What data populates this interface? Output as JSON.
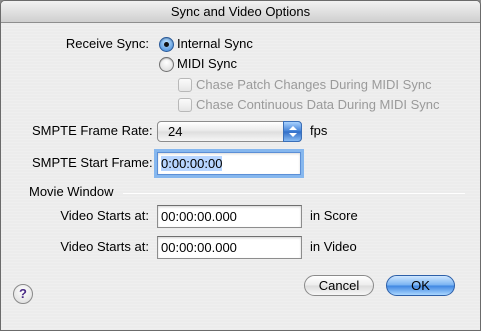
{
  "window": {
    "title": "Sync and Video Options"
  },
  "sync": {
    "label": "Receive Sync:",
    "options": [
      {
        "label": "Internal Sync",
        "selected": true
      },
      {
        "label": "MIDI Sync",
        "selected": false
      }
    ],
    "midi_options": [
      {
        "label": "Chase Patch Changes During MIDI Sync",
        "checked": false,
        "enabled": false
      },
      {
        "label": "Chase Continuous Data During MIDI Sync",
        "checked": false,
        "enabled": false
      }
    ]
  },
  "smpte": {
    "frame_rate_label": "SMPTE Frame Rate:",
    "frame_rate_value": "24",
    "frame_rate_unit": "fps",
    "start_frame_label": "SMPTE Start Frame:",
    "start_frame_value": "0:00:00:00"
  },
  "movie_window": {
    "group_label": "Movie Window",
    "score_label": "Video Starts at:",
    "score_value": "00:00:00.000",
    "score_suffix": "in Score",
    "video_label": "Video Starts at:",
    "video_value": "00:00:00.000",
    "video_suffix": "in Video"
  },
  "buttons": {
    "cancel": "Cancel",
    "ok": "OK",
    "help": "?"
  },
  "colors": {
    "accent": "#3f86e2",
    "focus_ring": "#86b7ee",
    "window_bg": "#ececec",
    "disabled_text": "#9a9a9a"
  }
}
